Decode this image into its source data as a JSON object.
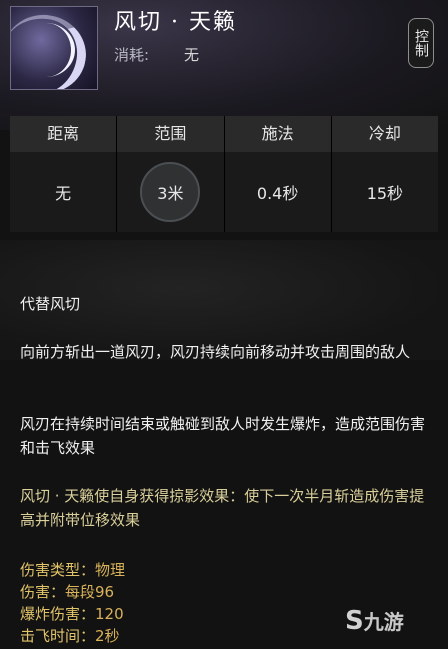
{
  "skill": {
    "title": "风切 · 天籁",
    "cost_label": "消耗:",
    "cost_value": "无",
    "tag": "控制"
  },
  "stats": [
    {
      "label": "距离",
      "value": "无"
    },
    {
      "label": "范围",
      "value": "3米"
    },
    {
      "label": "施法",
      "value": "0.4秒"
    },
    {
      "label": "冷却",
      "value": "15秒"
    }
  ],
  "description": [
    "代替风切",
    "向前方斩出一道风刃，风刃持续向前移动并攻击周围的敌人",
    "风刃在持续时间结束或触碰到敌人时发生爆炸，造成范围伤害和击飞效果",
    "风切 · 天籁使自身获得掠影效果：使下一次半月斩造成伤害提高并附带位移效果"
  ],
  "properties": [
    {
      "key": "伤害类型：",
      "value": "物理"
    },
    {
      "key": "伤害：",
      "value": "每段96"
    },
    {
      "key": "爆炸伤害：",
      "value": "120"
    },
    {
      "key": "击飞时间：",
      "value": "2秒"
    }
  ],
  "watermark": {
    "logo": "S",
    "text": "九游"
  }
}
